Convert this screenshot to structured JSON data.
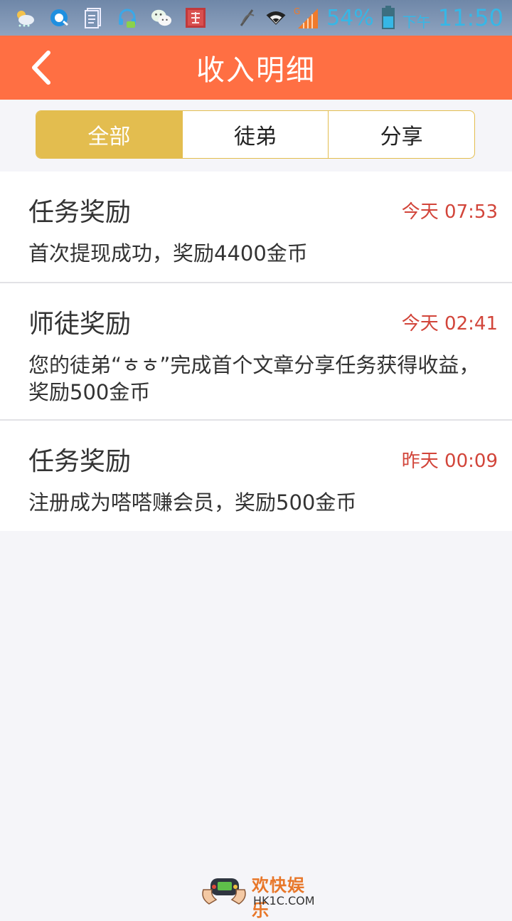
{
  "status_bar": {
    "icons": [
      "weather-icon",
      "browser-icon",
      "document-icon",
      "headset-icon",
      "wechat-icon",
      "mahjong-icon",
      "no-signal-icon",
      "wifi-icon",
      "signal-icon",
      "battery-icon"
    ],
    "signal_type": "G",
    "battery_percent": "54%",
    "ampm": "下午",
    "time": "11:50"
  },
  "header": {
    "title": "收入明细"
  },
  "tabs": [
    {
      "label": "全部",
      "active": true
    },
    {
      "label": "徒弟",
      "active": false
    },
    {
      "label": "分享",
      "active": false
    }
  ],
  "records": [
    {
      "title": "任务奖励",
      "time": "今天 07:53",
      "desc": "首次提现成功，奖励4400金币"
    },
    {
      "title": "师徒奖励",
      "time": "今天 02:41",
      "desc": "您的徒弟“ㅎㅎ”完成首个文章分享任务获得收益，奖励500金币"
    },
    {
      "title": "任务奖励",
      "time": "昨天 00:09",
      "desc": "注册成为嗒嗒赚会员，奖励500金币"
    }
  ],
  "watermark": {
    "name": "欢快娱乐",
    "domain": "HK1C.COM"
  },
  "colors": {
    "accent": "#ff6f43",
    "tab_active": "#e3bd4f",
    "time_red": "#d2453a",
    "status_blue": "#36b7e6"
  }
}
